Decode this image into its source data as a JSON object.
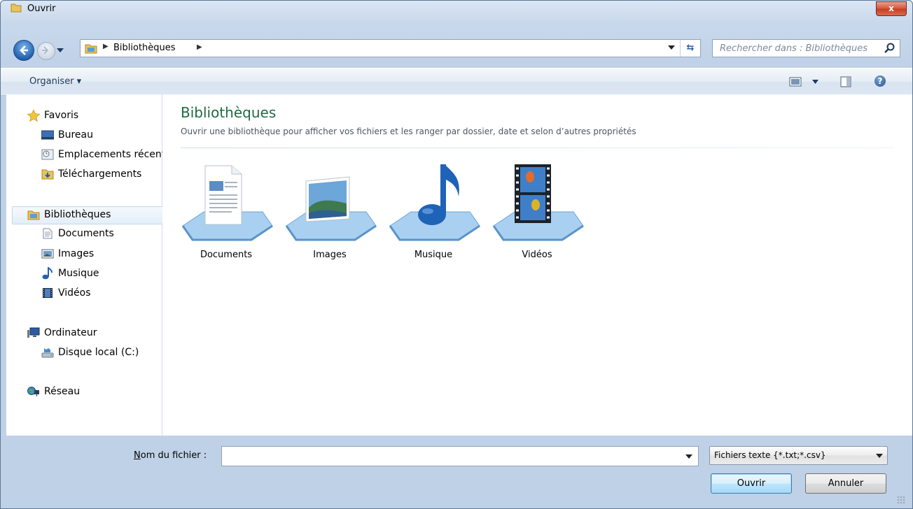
{
  "window": {
    "title": "Ouvrir",
    "close_label": "x"
  },
  "address": {
    "crumb": "Bibliothèques",
    "refresh_glyph": "⇆"
  },
  "search": {
    "placeholder": "Rechercher dans : Bibliothèques"
  },
  "toolbar": {
    "organize_label": "Organiser ▾"
  },
  "nav": {
    "favorites": {
      "label": "Favoris",
      "items": [
        "Bureau",
        "Emplacements récents",
        "Téléchargements"
      ]
    },
    "libraries": {
      "label": "Bibliothèques",
      "items": [
        "Documents",
        "Images",
        "Musique",
        "Vidéos"
      ]
    },
    "computer": {
      "label": "Ordinateur",
      "items": [
        "Disque local (C:)"
      ]
    },
    "network": {
      "label": "Réseau"
    }
  },
  "main": {
    "title": "Bibliothèques",
    "description": "Ouvrir une bibliothèque pour afficher vos fichiers et les ranger par dossier, date et selon d’autres propriétés",
    "libraries": [
      {
        "label": "Documents",
        "icon": "documents-library-icon"
      },
      {
        "label": "Images",
        "icon": "images-library-icon"
      },
      {
        "label": "Musique",
        "icon": "music-library-icon"
      },
      {
        "label": "Vidéos",
        "icon": "videos-library-icon"
      }
    ]
  },
  "footer": {
    "filename_label_accel": "N",
    "filename_label_rest": "om du fichier :",
    "filename_value": "",
    "filter_value": "Fichiers texte {*.txt;*.csv}",
    "open_label": "Ouvrir",
    "cancel_label": "Annuler"
  },
  "colors": {
    "title_green": "#1e6b3f",
    "accent_blue": "#2361b0",
    "close_red": "#c43d21"
  }
}
